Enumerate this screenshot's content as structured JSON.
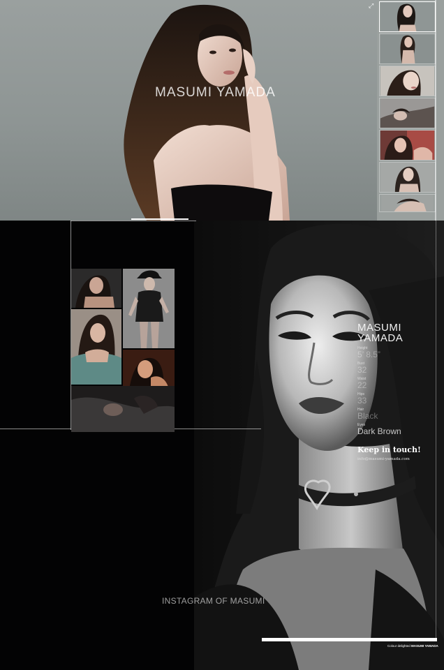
{
  "hero": {
    "title": "MASUMI YAMADA",
    "expand_icon": "expand-arrows-icon",
    "thumbnails": [
      {
        "name": "thumb-1",
        "selected": true
      },
      {
        "name": "thumb-2",
        "selected": false
      },
      {
        "name": "thumb-3",
        "selected": false
      },
      {
        "name": "thumb-4",
        "selected": false
      },
      {
        "name": "thumb-5",
        "selected": false
      },
      {
        "name": "thumb-6",
        "selected": false
      },
      {
        "name": "thumb-7",
        "selected": false
      }
    ],
    "scroll_down_icon": "chevron-down-icon"
  },
  "profile": {
    "name_line1": "MASUMI",
    "name_line2": "YAMADA",
    "stats": [
      {
        "label": "Height",
        "value": "5’ 8.5”"
      },
      {
        "label": "Bust",
        "value": "32"
      },
      {
        "label": "Waist",
        "value": "22"
      },
      {
        "label": "Hips",
        "value": "33"
      },
      {
        "label": "Hair",
        "value": "Black"
      },
      {
        "label": "Eyes",
        "value": "Dark Brown"
      }
    ]
  },
  "contact": {
    "heading": "Keep in touch!",
    "email": "info@masumi-yamada.com"
  },
  "instagram": {
    "heading": "INSTAGRAM OF MASUMI"
  },
  "footer": {
    "credit_prefix": "Colour delighted",
    "credit_name": "MASUMI YAMADA"
  },
  "colors": {
    "hero_bg": "#969c9b",
    "page_bg": "#000000",
    "accent": "#ffffff"
  }
}
